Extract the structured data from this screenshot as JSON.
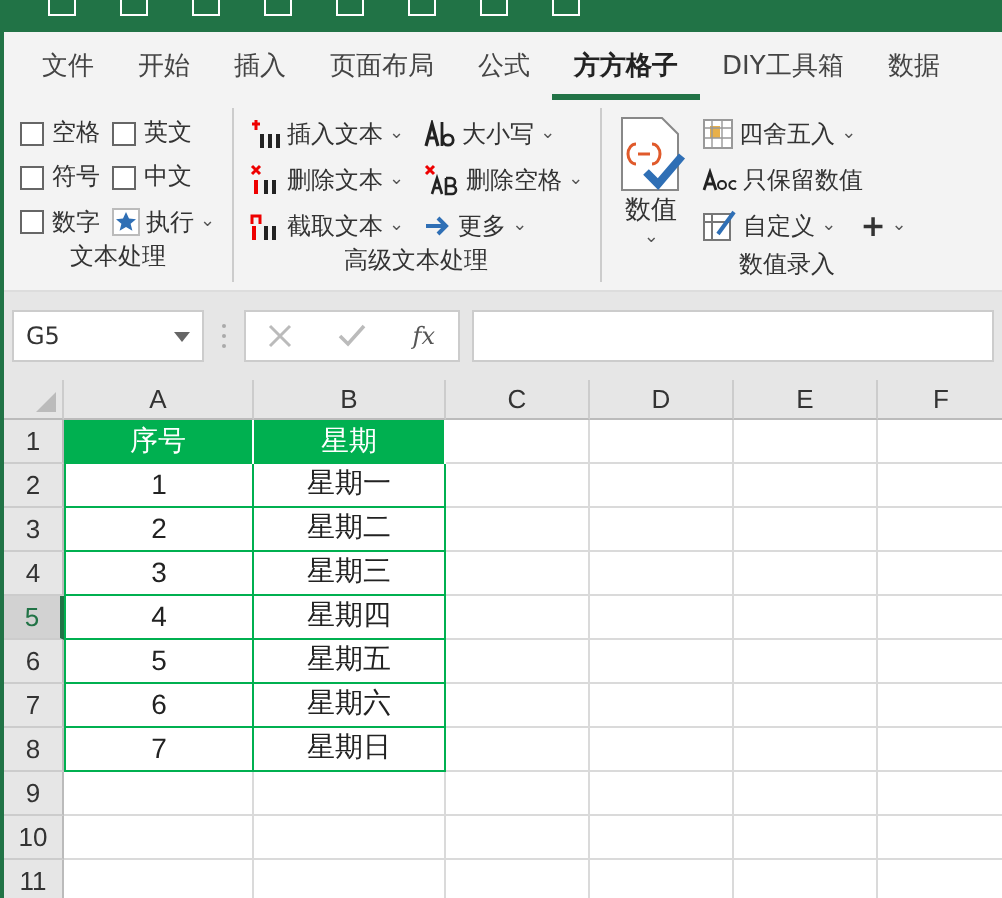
{
  "ribbon_tabs": [
    {
      "label": "文件",
      "selected": false
    },
    {
      "label": "开始",
      "selected": false
    },
    {
      "label": "插入",
      "selected": false
    },
    {
      "label": "页面布局",
      "selected": false
    },
    {
      "label": "公式",
      "selected": false
    },
    {
      "label": "方方格子",
      "selected": true
    },
    {
      "label": "DIY工具箱",
      "selected": false
    },
    {
      "label": "数据",
      "selected": false
    }
  ],
  "groups": [
    {
      "title": "文本处理",
      "checkboxes": [
        {
          "label": "空格",
          "checked": false
        },
        {
          "label": "英文",
          "checked": false
        },
        {
          "label": "符号",
          "checked": false
        },
        {
          "label": "中文",
          "checked": false
        },
        {
          "label": "数字",
          "checked": false
        }
      ],
      "run_button": {
        "label": "执行",
        "caret": "⌄"
      }
    },
    {
      "title": "高级文本处理",
      "commands": [
        {
          "kind": "insert",
          "label": "插入文本",
          "caret": "⌄"
        },
        {
          "kind": "case",
          "label": "大小写",
          "caret": "⌄"
        },
        {
          "kind": "delete",
          "label": "删除文本",
          "caret": "⌄"
        },
        {
          "kind": "trim",
          "label": "删除空格",
          "caret": "⌄"
        },
        {
          "kind": "extract",
          "label": "截取文本",
          "caret": "⌄"
        },
        {
          "kind": "more",
          "label": "更多",
          "caret": "⌄"
        }
      ]
    },
    {
      "title": "数值录入",
      "big_button": {
        "label": "数值",
        "caret": "⌄"
      },
      "commands": [
        {
          "kind": "round",
          "label": "四舍五入",
          "caret": "⌄"
        },
        {
          "kind": "numeric",
          "label": "只保留数值"
        },
        {
          "kind": "custom",
          "label": "自定义",
          "caret": "⌄"
        },
        {
          "kind": "plus",
          "label": "+",
          "caret": "⌄"
        }
      ]
    }
  ],
  "name_box": "G5",
  "formula_bar": {
    "fx": "fx"
  },
  "sheet": {
    "columns": [
      "A",
      "B",
      "C",
      "D",
      "E",
      "F"
    ],
    "rows": [
      {
        "number": "1",
        "selected": false,
        "cells": [
          "序号",
          "星期"
        ],
        "header": true
      },
      {
        "number": "2",
        "selected": false,
        "cells": [
          "1",
          "星期一"
        ],
        "header": false
      },
      {
        "number": "3",
        "selected": false,
        "cells": [
          "2",
          "星期二"
        ],
        "header": false
      },
      {
        "number": "4",
        "selected": false,
        "cells": [
          "3",
          "星期三"
        ],
        "header": false
      },
      {
        "number": "5",
        "selected": true,
        "cells": [
          "4",
          "星期四"
        ],
        "header": false
      },
      {
        "number": "6",
        "selected": false,
        "cells": [
          "5",
          "星期五"
        ],
        "header": false
      },
      {
        "number": "7",
        "selected": false,
        "cells": [
          "6",
          "星期六"
        ],
        "header": false
      },
      {
        "number": "8",
        "selected": false,
        "cells": [
          "7",
          "星期日"
        ],
        "header": false
      },
      {
        "number": "9",
        "selected": false,
        "cells": []
      },
      {
        "number": "10",
        "selected": false,
        "cells": []
      },
      {
        "number": "11",
        "selected": false,
        "cells": []
      }
    ]
  }
}
